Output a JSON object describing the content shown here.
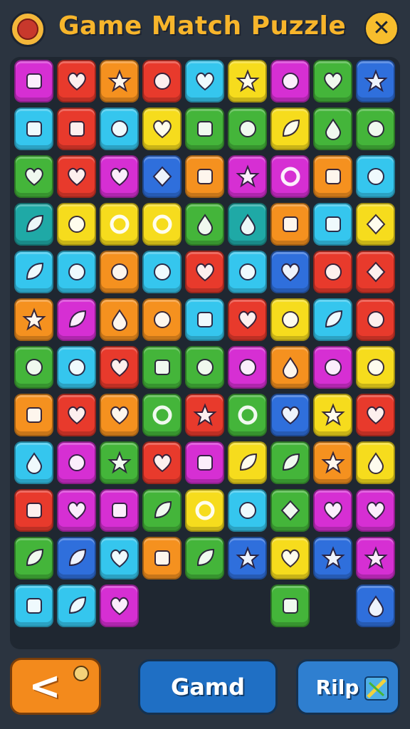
{
  "header": {
    "title": "Game Match Puzzle",
    "logo_icon": "lucky-charm-icon",
    "close_icon": "close-icon",
    "close_glyph": "✕"
  },
  "colors": {
    "magenta": "#d62fd3",
    "red": "#e83a2c",
    "orange": "#f5911f",
    "yellow": "#f6dc1d",
    "cyan": "#35c6ee",
    "blue": "#2f6fdc",
    "green": "#44b53a",
    "teal": "#1fa9a6",
    "pink": "#ee4a9a"
  },
  "tiles": [
    [
      "magenta",
      "box-icon"
    ],
    [
      "red",
      "heart-icon"
    ],
    [
      "orange",
      "star-blob-icon"
    ],
    [
      "red",
      "wand-icon"
    ],
    [
      "cyan",
      "heart-icon"
    ],
    [
      "yellow",
      "splat-icon"
    ],
    [
      "magenta",
      "question-icon"
    ],
    [
      "green",
      "heart-icon"
    ],
    [
      "blue",
      "flower-icon"
    ],
    [
      "cyan",
      "envelope-icon"
    ],
    [
      "red",
      "picture-icon"
    ],
    [
      "cyan",
      "crown-icon"
    ],
    [
      "yellow",
      "heart-icon"
    ],
    [
      "green",
      "eraser-icon"
    ],
    [
      "green",
      "brush-icon"
    ],
    [
      "yellow",
      "leaf-icon"
    ],
    [
      "green",
      "bell-icon"
    ],
    [
      "green",
      "bird-icon"
    ],
    [
      "green",
      "heart-icon"
    ],
    [
      "red",
      "apple-icon"
    ],
    [
      "magenta",
      "apple-icon"
    ],
    [
      "blue",
      "plane-icon"
    ],
    [
      "orange",
      "crate-icon"
    ],
    [
      "magenta",
      "flower-icon"
    ],
    [
      "magenta",
      "target-icon"
    ],
    [
      "orange",
      "basket-icon"
    ],
    [
      "cyan",
      "bandage-icon"
    ],
    [
      "teal",
      "leaf-icon"
    ],
    [
      "yellow",
      "cookie-icon"
    ],
    [
      "yellow",
      "ring-icon"
    ],
    [
      "yellow",
      "disc-icon"
    ],
    [
      "green",
      "orb-icon"
    ],
    [
      "teal",
      "drop-icon"
    ],
    [
      "orange",
      "chest-icon"
    ],
    [
      "cyan",
      "phone-icon"
    ],
    [
      "yellow",
      "gem-icon"
    ],
    [
      "cyan",
      "leaf-icon"
    ],
    [
      "cyan",
      "bolt-icon"
    ],
    [
      "orange",
      "bottle-icon"
    ],
    [
      "cyan",
      "lambda-icon"
    ],
    [
      "red",
      "heart-icon"
    ],
    [
      "cyan",
      "snail-icon"
    ],
    [
      "blue",
      "heart-icon"
    ],
    [
      "red",
      "tree-icon"
    ],
    [
      "red",
      "diamond-icon"
    ],
    [
      "orange",
      "star-blob-icon"
    ],
    [
      "magenta",
      "feather-icon"
    ],
    [
      "orange",
      "pin-icon"
    ],
    [
      "orange",
      "cookie-icon"
    ],
    [
      "cyan",
      "block-icon"
    ],
    [
      "red",
      "apple-icon"
    ],
    [
      "yellow",
      "eye-icon"
    ],
    [
      "cyan",
      "leaf-icon"
    ],
    [
      "red",
      "cloud-icon"
    ],
    [
      "green",
      "bottle-icon"
    ],
    [
      "cyan",
      "bean-icon"
    ],
    [
      "red",
      "heart-icon"
    ],
    [
      "green",
      "frame-icon"
    ],
    [
      "green",
      "brush-icon"
    ],
    [
      "magenta",
      "hammer-icon"
    ],
    [
      "orange",
      "vase-icon"
    ],
    [
      "magenta",
      "sprout-icon"
    ],
    [
      "yellow",
      "blob-icon"
    ],
    [
      "orange",
      "note-icon"
    ],
    [
      "red",
      "heart-icon"
    ],
    [
      "orange",
      "heart-icon"
    ],
    [
      "green",
      "ring-icon"
    ],
    [
      "red",
      "star-icon"
    ],
    [
      "green",
      "mirror-icon"
    ],
    [
      "blue",
      "heart-icon"
    ],
    [
      "yellow",
      "splat-icon"
    ],
    [
      "red",
      "heart-icon"
    ],
    [
      "cyan",
      "egg-icon"
    ],
    [
      "magenta",
      "glyph-icon"
    ],
    [
      "green",
      "star-icon"
    ],
    [
      "red",
      "apple-icon"
    ],
    [
      "magenta",
      "gold-bar-icon"
    ],
    [
      "yellow",
      "tulip-icon"
    ],
    [
      "green",
      "leaf-icon"
    ],
    [
      "orange",
      "puzzle-icon"
    ],
    [
      "yellow",
      "egg-icon"
    ],
    [
      "red",
      "clipboard-icon"
    ],
    [
      "magenta",
      "heart-icon"
    ],
    [
      "magenta",
      "bucket-icon"
    ],
    [
      "green",
      "flame-icon"
    ],
    [
      "yellow",
      "ring-icon"
    ],
    [
      "cyan",
      "plus-icon"
    ],
    [
      "green",
      "shield-icon"
    ],
    [
      "magenta",
      "heart-icon"
    ],
    [
      "magenta",
      "heart-icon"
    ],
    [
      "green",
      "flame-icon"
    ],
    [
      "blue",
      "tulip-icon"
    ],
    [
      "cyan",
      "heart-icon"
    ],
    [
      "orange",
      "frame-icon"
    ],
    [
      "green",
      "leaf-icon"
    ],
    [
      "blue",
      "star-icon"
    ],
    [
      "yellow",
      "heart-icon"
    ],
    [
      "blue",
      "star-icon"
    ],
    [
      "magenta",
      "splat-icon"
    ],
    [
      "cyan",
      "note-icon"
    ],
    [
      "cyan",
      "sword-icon"
    ],
    [
      "magenta",
      "heart-icon"
    ],
    null,
    null,
    null,
    [
      "green",
      "pot-icon"
    ],
    null,
    [
      "blue",
      "orb-icon"
    ]
  ],
  "footer": {
    "back_glyph": "<",
    "back_icon": "chevron-left-icon",
    "mid_label": "Gamd",
    "right_label": "Rilp",
    "right_icon": "shuffle-icon"
  }
}
